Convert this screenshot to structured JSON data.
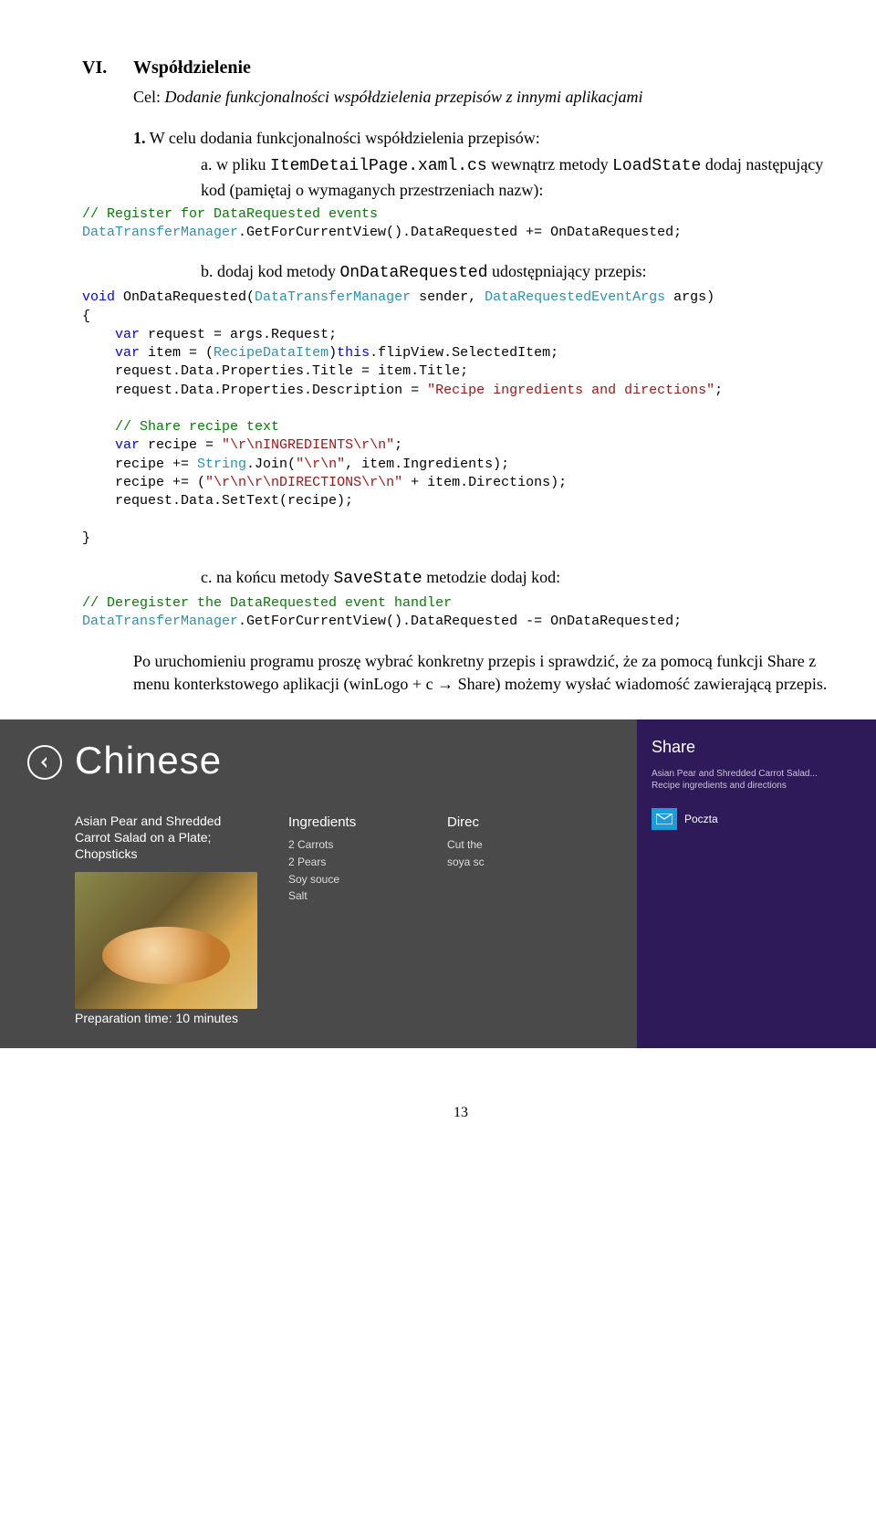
{
  "section": {
    "roman": "VI.",
    "title": "Współdzielenie",
    "goal_prefix": "Cel: ",
    "goal": "Dodanie funkcjonalności współdzielenia przepisów z innymi aplikacjami"
  },
  "step1": {
    "num": "1.",
    "text": "W celu dodania funkcjonalności współdzielenia przepisów:"
  },
  "sub_a": {
    "letter": "a.",
    "t1": "w pliku ",
    "mono1": "ItemDetailPage.xaml.cs",
    "t2": " wewnątrz metody ",
    "mono2": "LoadState",
    "t3": " dodaj następujący kod (pamiętaj o wymaganych przestrzeniach nazw):"
  },
  "code_a": {
    "c1": "// Register for DataRequested events",
    "l2_a": "DataTransferManager",
    "l2_b": ".GetForCurrentView().DataRequested += OnDataRequested;"
  },
  "sub_b": {
    "letter": "b.",
    "t1": "dodaj kod metody ",
    "mono1": "OnDataRequested",
    "t2": " udostępniający przepis:"
  },
  "code_b": {
    "l1_a": "void",
    "l1_b": " OnDataRequested(",
    "l1_c": "DataTransferManager",
    "l1_d": " sender, ",
    "l1_e": "DataRequestedEventArgs",
    "l1_f": " args)",
    "l2": "{",
    "l3_a": "    var",
    "l3_b": " request = args.Request;",
    "l4_a": "    var",
    "l4_b": " item = (",
    "l4_c": "RecipeDataItem",
    "l4_d": ")",
    "l4_e": "this",
    "l4_f": ".flipView.SelectedItem;",
    "l5": "    request.Data.Properties.Title = item.Title;",
    "l6_a": "    request.Data.Properties.Description = ",
    "l6_b": "\"Recipe ingredients and directions\"",
    "l6_c": ";",
    "blank1": "",
    "l7": "    // Share recipe text",
    "l8_a": "    var",
    "l8_b": " recipe = ",
    "l8_c": "\"\\r\\nINGREDIENTS\\r\\n\"",
    "l8_d": ";",
    "l9_a": "    recipe += ",
    "l9_b": "String",
    "l9_c": ".Join(",
    "l9_d": "\"\\r\\n\"",
    "l9_e": ", item.Ingredients);",
    "l10_a": "    recipe += (",
    "l10_b": "\"\\r\\n\\r\\nDIRECTIONS\\r\\n\"",
    "l10_c": " + item.Directions);",
    "l11": "    request.Data.SetText(recipe);",
    "blank2": "",
    "l12": "}"
  },
  "sub_c": {
    "letter": "c.",
    "t1": "na końcu metody ",
    "mono1": "SaveState",
    "t2": " metodzie dodaj kod:"
  },
  "code_c": {
    "c1": "// Deregister the DataRequested event handler",
    "l2_a": "DataTransferManager",
    "l2_b": ".GetForCurrentView().DataRequested -= OnDataRequested;"
  },
  "para": "Po uruchomieniu programu proszę wybrać konkretny przepis i sprawdzić, że za pomocą funkcji Share z menu konterkstowego aplikacji (winLogo + c → Share) możemy wysłać wiadomość zawierającą przepis.",
  "app": {
    "title": "Chinese",
    "subtitle": "Asian Pear and Shredded Carrot Salad on a Plate; Chopsticks",
    "ingredients_head": "Ingredients",
    "ingredients": [
      "2 Carrots",
      "2 Pears",
      "Soy souce",
      "Salt"
    ],
    "directions_head": "Direc",
    "directions_cut": "Cut the",
    "directions_soya": "soya sc",
    "prep": "Preparation time: 10 minutes"
  },
  "share": {
    "title": "Share",
    "sub1": "Asian Pear and Shredded Carrot Salad...",
    "sub2": "Recipe ingredients and directions",
    "mail": "Poczta"
  },
  "pagenum": "13"
}
